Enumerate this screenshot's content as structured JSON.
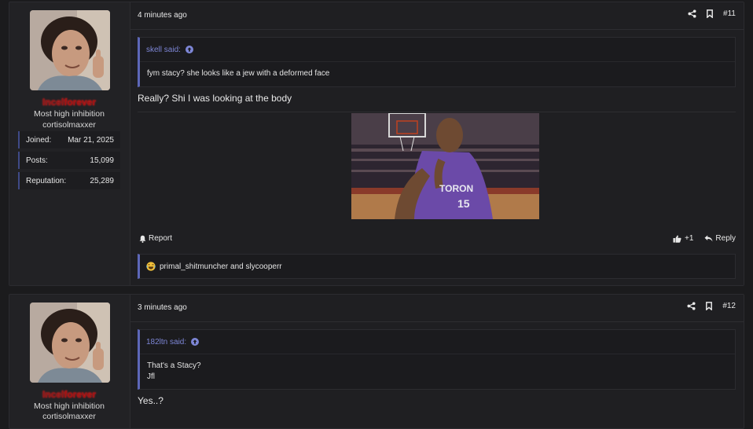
{
  "posts": [
    {
      "time": "4 minutes ago",
      "number": "#11",
      "user": {
        "name_a": "Incel",
        "name_b": "forever",
        "title": "Most high inhibition",
        "subtitle": "cortisolmaxxer",
        "stats": [
          {
            "label": "Joined:",
            "value": "Mar 21, 2025"
          },
          {
            "label": "Posts:",
            "value": "15,099"
          },
          {
            "label": "Reputation:",
            "value": "25,289"
          }
        ]
      },
      "quote": {
        "author": "skell said:",
        "lines": [
          "fym stacy? she looks like a jew with a deformed face"
        ]
      },
      "message": "Really? Shi I was looking at the body",
      "footer": {
        "report": "Report",
        "likes": "+1",
        "reply": "Reply"
      },
      "reactions": "primal_shitmuncher and slycooperr"
    },
    {
      "time": "3 minutes ago",
      "number": "#12",
      "user": {
        "name_a": "Incel",
        "name_b": "forever",
        "title": "Most high inhibition",
        "subtitle": "cortisolmaxxer"
      },
      "quote": {
        "author": "182ltn said:",
        "lines": [
          "That's a Stacy?",
          "Jfl"
        ]
      },
      "message": "Yes..?"
    }
  ],
  "colors": {
    "accent": "#5d67b8",
    "username": "#8b1a1a",
    "background": "#1b1b1d"
  },
  "icons": [
    "share-icon",
    "bookmark-icon",
    "arrow-up-circle-icon",
    "bell-icon",
    "thumbs-up-icon",
    "reply-icon",
    "laughing-emoji-icon"
  ]
}
